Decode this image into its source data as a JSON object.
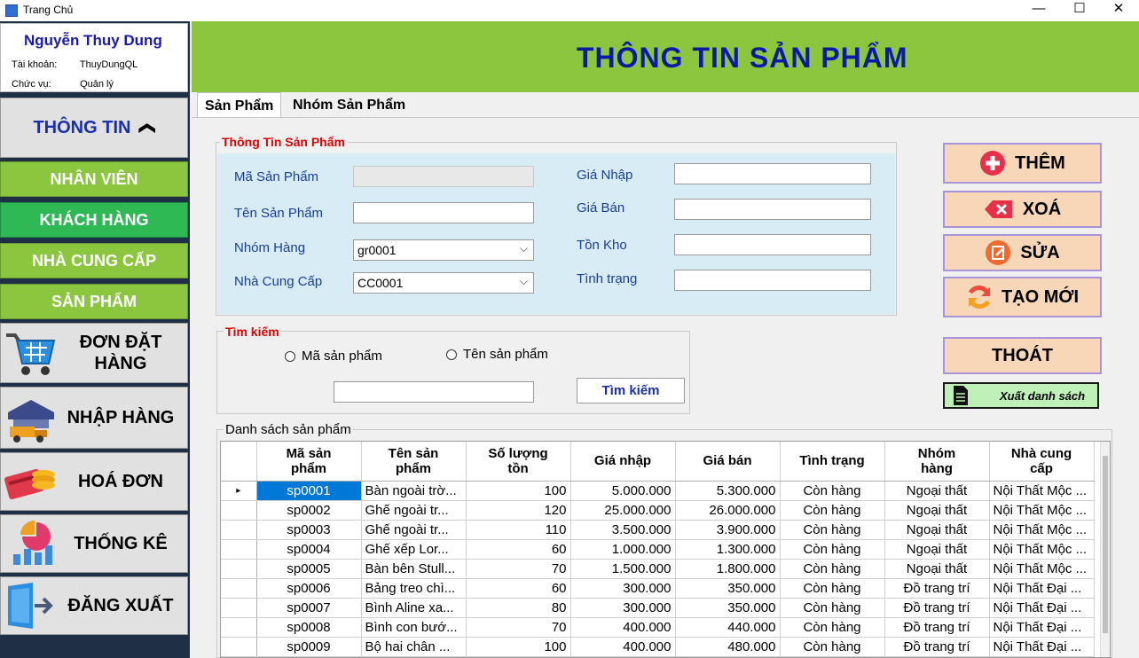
{
  "window": {
    "title": "Trang Chủ",
    "minimize": "—",
    "maximize": "☐",
    "close": "✕"
  },
  "user": {
    "name": "Nguyễn Thuy Dung",
    "account_label": "Tài khoản:",
    "account_value": "ThuyDungQL",
    "role_label": "Chức vụ:",
    "role_value": "Quản lý"
  },
  "sidebar": {
    "info_label": "THÔNG TIN",
    "info_chevron": "❮",
    "items": [
      {
        "label": "NHÂN VIÊN",
        "icon": "none"
      },
      {
        "label": "KHÁCH HÀNG",
        "icon": "none"
      },
      {
        "label": "NHÀ CUNG CẤP",
        "icon": "none"
      },
      {
        "label": "SẢN PHẨM",
        "icon": "none"
      }
    ],
    "main_items": [
      {
        "label_line1": "ĐƠN ĐẶT",
        "label_line2": "HÀNG",
        "icon": "shopping-cart-icon"
      },
      {
        "label": "NHẬP HÀNG",
        "icon": "warehouse-truck-icon"
      },
      {
        "label": "HOÁ ĐƠN",
        "icon": "coins-card-icon"
      },
      {
        "label": "THỐNG KÊ",
        "icon": "pie-chart-icon"
      },
      {
        "label": "ĐĂNG XUẤT",
        "icon": "logout-icon"
      }
    ]
  },
  "header": {
    "title": "THÔNG TIN SẢN PHẨM"
  },
  "tabs": [
    {
      "label": "Sản Phẩm"
    },
    {
      "label": "Nhóm Sản Phẩm"
    }
  ],
  "product_info": {
    "group_title": "Thông Tin Sản Phẩm",
    "code_label": "Mã Sản Phẩm",
    "code_value": "",
    "name_label": "Tên Sản Phẩm",
    "name_value": "",
    "group_label": "Nhóm Hàng",
    "group_value": "gr0001",
    "supplier_label": "Nhà Cung Cấp",
    "supplier_value": "CC0001",
    "import_price_label": "Giá Nhập",
    "import_price_value": "",
    "sale_price_label": "Giá Bán",
    "sale_price_value": "",
    "stock_label": "Tồn Kho",
    "stock_value": "",
    "status_label": "Tình trạng",
    "status_value": ""
  },
  "search": {
    "group_title": "Tìm kiếm",
    "radio_code": "Mã sản phẩm",
    "radio_name": "Tên sản phẩm",
    "input_value": "",
    "button": "Tìm kiếm"
  },
  "actions": {
    "add": "THÊM",
    "delete": "XOÁ",
    "edit": "SỬA",
    "new": "TẠO MỚI",
    "exit": "THOÁT",
    "export": "Xuất danh sách"
  },
  "colors": {
    "accent_green": "#8cc63f",
    "title_blue": "#0b1aa8",
    "group_red": "#e00000",
    "selection_blue": "#0078d7",
    "action_bg": "#f8d7b8"
  },
  "list": {
    "title": "Danh sách sản phẩm",
    "columns": [
      {
        "l1": "Mã sản",
        "l2": "phẩm"
      },
      {
        "l1": "Tên sản",
        "l2": "phẩm"
      },
      {
        "l1": "Số lượng",
        "l2": "tồn"
      },
      {
        "l1": "Giá nhập",
        "l2": ""
      },
      {
        "l1": "Giá bán",
        "l2": ""
      },
      {
        "l1": "Tình trạng",
        "l2": ""
      },
      {
        "l1": "Nhóm",
        "l2": "hàng"
      },
      {
        "l1": "Nhà cung",
        "l2": "cấp"
      }
    ],
    "rows": [
      [
        "sp0001",
        "Bàn ngoài trờ...",
        "100",
        "5.000.000",
        "5.300.000",
        "Còn hàng",
        "Ngoại thất",
        "Nội Thất Mộc ..."
      ],
      [
        "sp0002",
        "Ghế ngoài tr...",
        "120",
        "25.000.000",
        "26.000.000",
        "Còn hàng",
        "Ngoại thất",
        "Nội Thất Mộc ..."
      ],
      [
        "sp0003",
        "Ghế ngoài tr...",
        "110",
        "3.500.000",
        "3.900.000",
        "Còn hàng",
        "Ngoại thất",
        "Nội Thất Mộc ..."
      ],
      [
        "sp0004",
        "Ghế xếp Lor...",
        "60",
        "1.000.000",
        "1.300.000",
        "Còn hàng",
        "Ngoại thất",
        "Nội Thất Mộc ..."
      ],
      [
        "sp0005",
        "Bàn bên Stull...",
        "70",
        "1.500.000",
        "1.800.000",
        "Còn hàng",
        "Ngoại thất",
        "Nội Thất Mộc ..."
      ],
      [
        "sp0006",
        "Bảng treo chì...",
        "60",
        "300.000",
        "350.000",
        "Còn hàng",
        "Đồ trang trí",
        "Nội Thất Đại ..."
      ],
      [
        "sp0007",
        "Bình Aline xa...",
        "80",
        "300.000",
        "350.000",
        "Còn hàng",
        "Đồ trang trí",
        "Nội Thất Đại ..."
      ],
      [
        "sp0008",
        "Bình con bướ...",
        "70",
        "400.000",
        "440.000",
        "Còn hàng",
        "Đồ trang trí",
        "Nội Thất Đại ..."
      ],
      [
        "sp0009",
        "Bộ hai chân ...",
        "100",
        "400.000",
        "480.000",
        "Còn hàng",
        "Đồ trang trí",
        "Nội Thất Đại ..."
      ]
    ]
  }
}
